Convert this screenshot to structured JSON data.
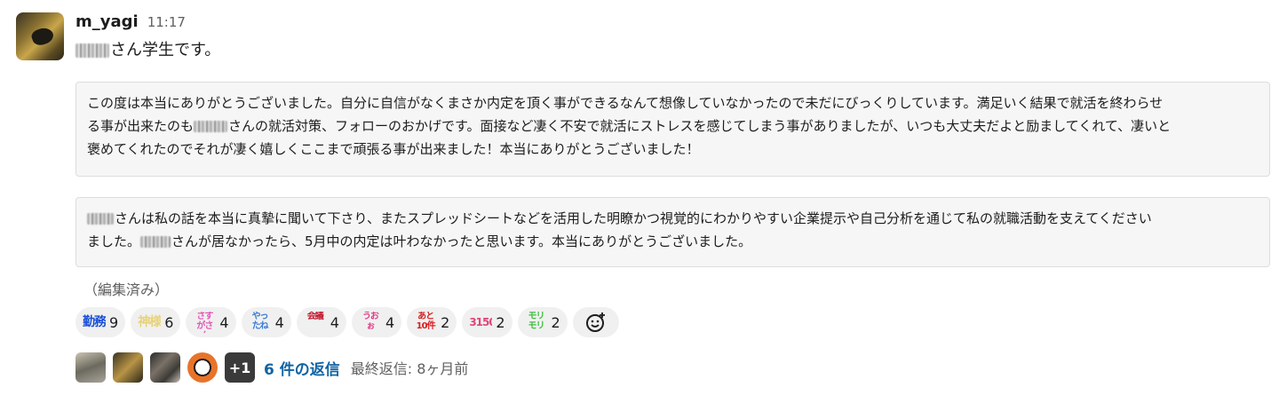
{
  "message": {
    "username": "m_yagi",
    "timestamp": "11:17",
    "first_line_suffix": "さん学生です。",
    "quote1": {
      "line1": "この度は本当にありがとうございました。自分に自信がなくまさか内定を頂く事ができるなんて想像していなかったので未だにびっくりしています。満足いく結果で就活を終わらせ",
      "line2_before": "る事が出来たのも",
      "line2_after": "さんの就活対策、フォローのおかげです。面接など凄く不安で就活にストレスを感じてしまう事がありましたが、いつも大丈夫だよと励ましてくれて、凄いと",
      "line3": "褒めてくれたのでそれが凄く嬉しくここまで頑張る事が出来ました！本当にありがとうございました！"
    },
    "quote2": {
      "line1_after": "さんは私の話を本当に真摯に聞いて下さり、またスプレッドシートなどを活用した明瞭かつ視覚的にわかりやすい企業提示や自己分析を通じて私の就職活動を支えてください",
      "line2_before": "ました。",
      "line2_after": "さんが居なかったら、5月中の内定は叶わなかったと思います。本当にありがとうございました。"
    },
    "edited_label": "（編集済み）"
  },
  "reactions": [
    {
      "icon": "kinsei-emoji",
      "text": "勤務",
      "color": "#1a4fd6",
      "count": "9"
    },
    {
      "icon": "kamisama-emoji",
      "text": "神様",
      "color": "#e8d27a",
      "count": "6"
    },
    {
      "icon": "sasuga-emoji",
      "text": "さすがさん",
      "color": "#e255b8",
      "count": "4"
    },
    {
      "icon": "yattane-emoji",
      "text": "やったね",
      "color": "#3a7bd5",
      "count": "4"
    },
    {
      "icon": "kaigi-emoji",
      "text": "会議",
      "color": "#c0162a",
      "count": "4"
    },
    {
      "icon": "uooo-emoji",
      "text": "うおぉ",
      "color": "#e23e8a",
      "count": "4"
    },
    {
      "icon": "ato10ken-emoji",
      "text": "あと10件",
      "color": "#d61f1f",
      "count": "2"
    },
    {
      "icon": "3150-emoji",
      "text": "3150",
      "color": "#e0457b",
      "count": "2"
    },
    {
      "icon": "morimori-emoji",
      "text": "モリモリ",
      "color": "#3fbf3f",
      "count": "2"
    }
  ],
  "thread": {
    "more_count": "+1",
    "reply_count": "6 件の返信",
    "last_reply": "最終返信: 8ヶ月前"
  }
}
